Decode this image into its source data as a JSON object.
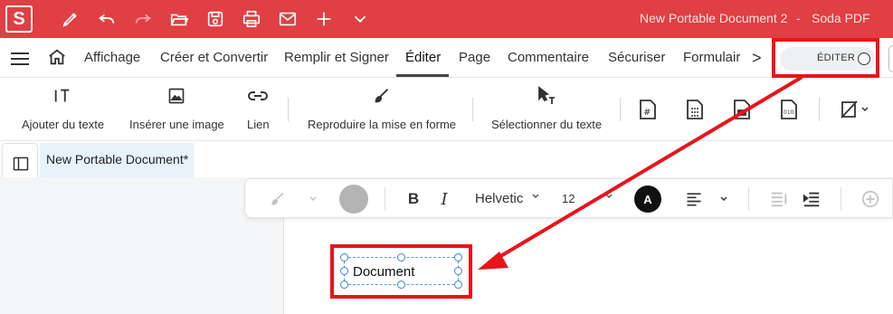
{
  "app": {
    "logo_letter": "S",
    "document_title": "New Portable Document 2",
    "title_separator": "-",
    "app_name": "Soda PDF",
    "accent_color": "#e03f43"
  },
  "title_icons": [
    "pen-icon",
    "undo-icon",
    "redo-icon",
    "open-folder-icon",
    "save-icon",
    "print-icon",
    "mail-icon",
    "add-icon",
    "chevron-down-icon"
  ],
  "menu": {
    "tabs": [
      {
        "label": "Affichage"
      },
      {
        "label": "Créer et Convertir"
      },
      {
        "label": "Remplir et Signer"
      },
      {
        "label": "Éditer"
      },
      {
        "label": "Page"
      },
      {
        "label": "Commentaire"
      },
      {
        "label": "Sécuriser"
      },
      {
        "label": "Formulair"
      }
    ],
    "active_tab": "Éditer",
    "more_chevron": ">",
    "edit_toggle_label": "ÉDITER"
  },
  "ribbon": {
    "buttons": [
      {
        "label": "Ajouter du texte",
        "icon": "add-text-icon"
      },
      {
        "label": "Insérer une image",
        "icon": "image-icon"
      },
      {
        "label": "Lien",
        "icon": "link-icon"
      },
      {
        "label": "Reproduire la mise en forme",
        "icon": "format-painter-icon"
      },
      {
        "label": "Sélectionner du texte",
        "icon": "select-text-icon"
      }
    ],
    "small_icons": [
      "page-number-icon",
      "document-grid-icon",
      "document-icon",
      "binary-document-icon",
      "no-edit-icon"
    ]
  },
  "left_rail": {
    "icons": [
      "panel-icon",
      "bookmark-icon"
    ]
  },
  "document_tab": {
    "label": "New Portable Document*"
  },
  "text_toolbar": {
    "font_name": "Helvetic",
    "font_size": "12",
    "text_color_letter": "A",
    "bold_label": "B",
    "italic_label": "I"
  },
  "text_box": {
    "value": "Document"
  },
  "annotation_color": "#e8141b"
}
